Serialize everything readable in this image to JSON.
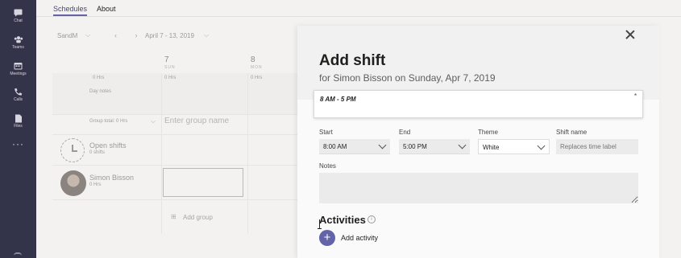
{
  "rail": {
    "items": [
      {
        "label": "Chat",
        "icon": "chat-icon"
      },
      {
        "label": "Teams",
        "icon": "teams-icon"
      },
      {
        "label": "Meetings",
        "icon": "calendar-icon"
      },
      {
        "label": "Calls",
        "icon": "phone-icon"
      },
      {
        "label": "Files",
        "icon": "file-icon"
      }
    ],
    "more": "···"
  },
  "tabs": [
    {
      "label": "Schedules",
      "active": true
    },
    {
      "label": "About",
      "active": false
    }
  ],
  "schedule": {
    "team": "SandM",
    "arrows": "‹ ›",
    "date_range": "April 7 - 13, 2019",
    "days": [
      {
        "num": "7",
        "name": "SUN"
      },
      {
        "num": "8",
        "name": "MON"
      }
    ],
    "hours_zero": "0 Hrs",
    "day_notes": "Day notes",
    "group_total": "Group total: 0 Hrs",
    "group_placeholder": "Enter group name",
    "open_shifts": "Open shifts",
    "open_shifts_count": "0 shifts",
    "person": "Simon Bisson",
    "person_hours": "0 Hrs",
    "add_group": "Add group"
  },
  "panel": {
    "title": "Add shift",
    "subtitle": "for Simon Bisson on Sunday, Apr 7, 2019",
    "shift_label": "8 AM - 5 PM",
    "required_mark": "*",
    "fields": {
      "start_label": "Start",
      "start_value": "8:00 AM",
      "end_label": "End",
      "end_value": "5:00 PM",
      "theme_label": "Theme",
      "theme_value": "White",
      "name_label": "Shift name",
      "name_placeholder": "Replaces time label"
    },
    "notes_label": "Notes",
    "activities_title": "Activities",
    "info": "i",
    "add_activity": "Add activity",
    "add_plus": "+",
    "accent": "#6264a7"
  }
}
